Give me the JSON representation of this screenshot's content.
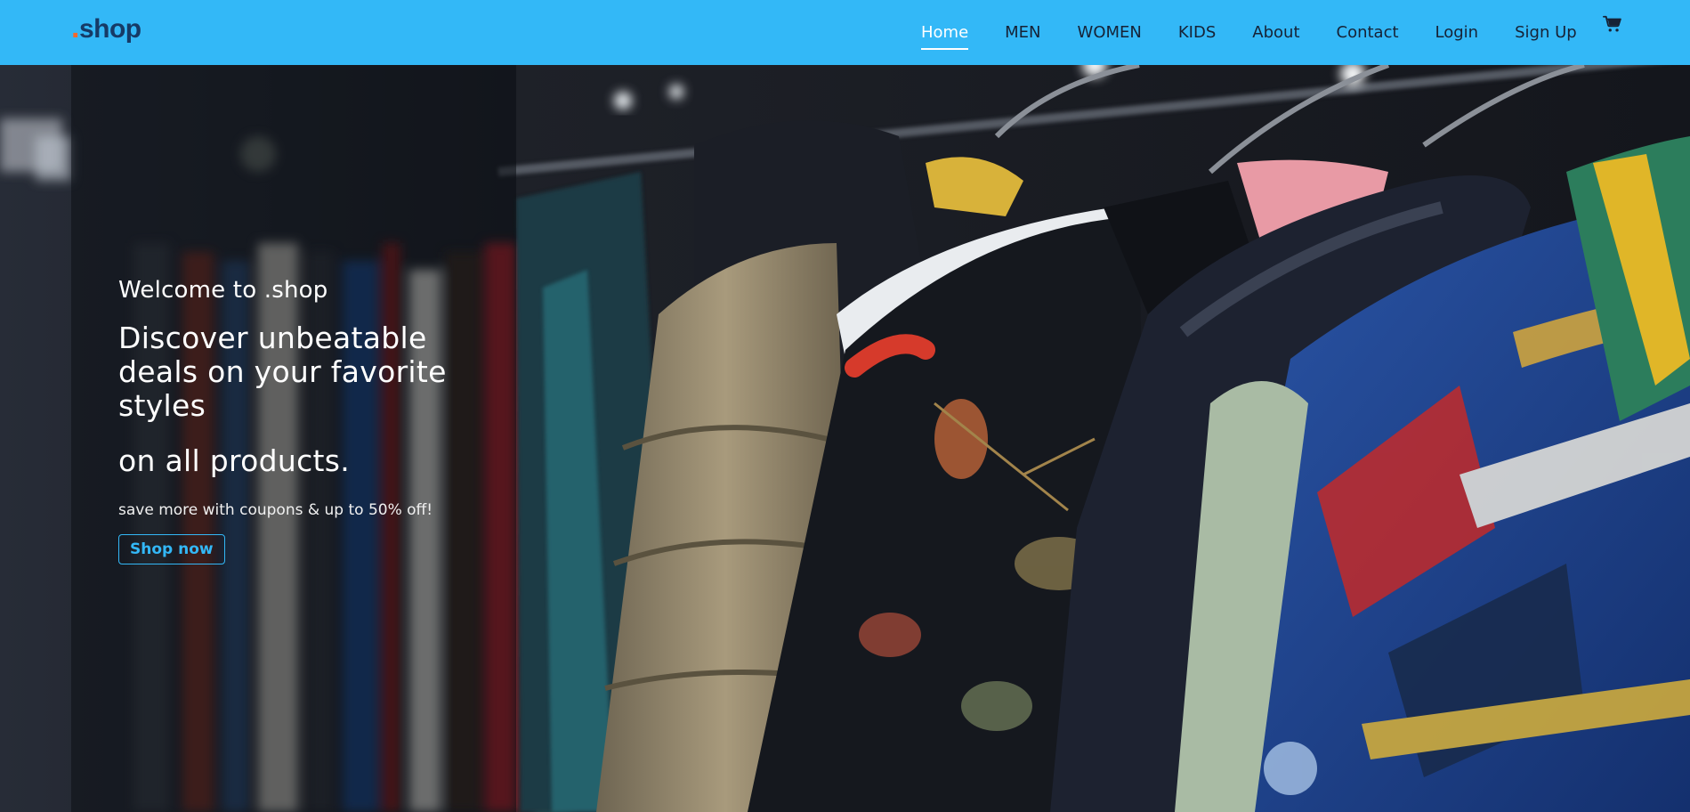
{
  "brand": {
    "dot": ".",
    "name": "shop"
  },
  "nav": {
    "items": [
      {
        "label": "Home",
        "active": true
      },
      {
        "label": "MEN"
      },
      {
        "label": "WOMEN"
      },
      {
        "label": "KIDS"
      },
      {
        "label": "About"
      },
      {
        "label": "Contact"
      },
      {
        "label": "Login"
      },
      {
        "label": "Sign Up"
      }
    ],
    "cart_icon": "cart-icon"
  },
  "hero": {
    "welcome": "Welcome to .shop",
    "headline": "Discover unbeatable deals on your favorite styles",
    "headline_line2": "on all products.",
    "subtext": "save more with coupons & up to 50% off!",
    "cta_label": "Shop now"
  },
  "colors": {
    "navbar": "#33b8f7",
    "logo_text": "#163a66",
    "logo_dot": "#f2682b",
    "accent": "#33b8f7"
  }
}
